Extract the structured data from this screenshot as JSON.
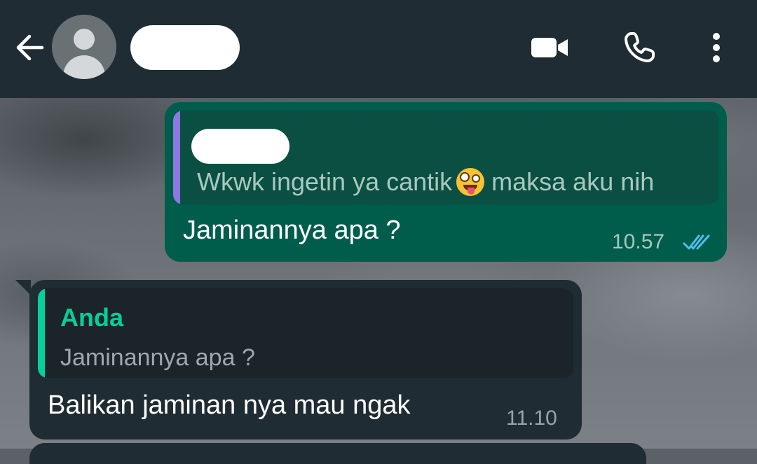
{
  "header": {
    "back_icon": "arrow-left-icon",
    "avatar_icon": "default-avatar-icon",
    "contact_name": "",
    "actions": [
      {
        "name": "video-call",
        "icon": "video-camera-icon"
      },
      {
        "name": "voice-call",
        "icon": "phone-icon"
      },
      {
        "name": "more-options",
        "icon": "three-dots-vertical-icon"
      }
    ]
  },
  "messages": [
    {
      "direction": "outgoing",
      "quote": {
        "author": "",
        "text_before_emoji": "Wkwk ingetin ya cantik",
        "emoji": "zany-face-emoji",
        "text_after_emoji": "maksa aku nih",
        "accent_color": "#8b78e0"
      },
      "text": "Jaminannya apa ?",
      "time": "10.57",
      "status": "read",
      "status_icon": "double-check-icon",
      "status_color": "#53bdeb"
    },
    {
      "direction": "incoming",
      "quote": {
        "author": "Anda",
        "text": "Jaminannya apa ?",
        "accent_color": "#06cf9c"
      },
      "text": "Balikan jaminan nya mau ngak",
      "time": "11.10"
    }
  ],
  "colors": {
    "header_bg": "#1f2c34",
    "outgoing_bubble": "#005c4b",
    "incoming_bubble": "#202c33"
  }
}
